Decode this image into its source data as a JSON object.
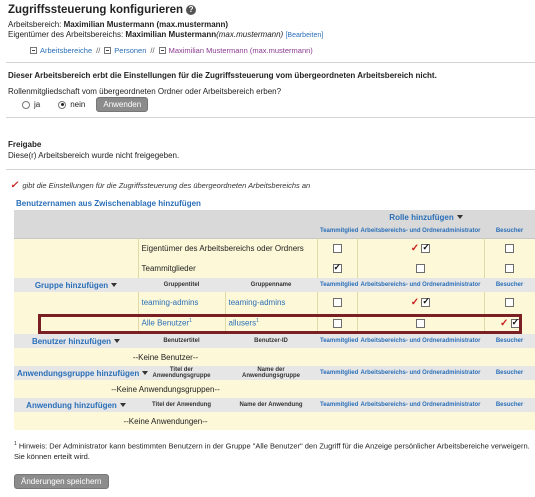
{
  "page": {
    "title": "Zugriffssteuerung konfigurieren",
    "workspace_label": "Arbeitsbereich:",
    "workspace_value": "Maximilian Mustermann (max.mustermann)",
    "owner_label": "Eigentümer des Arbeitsbereichs:",
    "owner_name": "Maximilian Mustermann",
    "owner_user": "(max.mustermann)",
    "edit_link": "[Bearbeiten]"
  },
  "breadcrumbs": {
    "items": [
      "Arbeitsbereiche",
      "Personen",
      "Maximilian Mustermann (max.mustermann)"
    ],
    "separator": "//"
  },
  "inherit": {
    "heading": "Dieser Arbeitsbereich erbt die Einstellungen für die Zugriffssteuerung vom übergeordneten Arbeitsbereich nicht.",
    "question": "Rollenmitgliedschaft vom übergeordneten Ordner oder Arbeitsbereich erben?",
    "option_yes": "ja",
    "option_no": "nein",
    "selected": "nein",
    "apply_button": "Anwenden"
  },
  "release": {
    "heading": "Freigabe",
    "text": "Diese(r) Arbeitsbereich wurde nicht freigegeben."
  },
  "legend_text": "gibt die Einstellungen für die Zugriffssteuerung des übergeordneten Arbeitsbereichs an",
  "clipboard_link": "Benutzernamen aus Zwischenablage hinzufügen",
  "table": {
    "add_role": "Rolle hinzufügen",
    "role_headers": [
      "Teammitglied",
      "Arbeitsbereichs- und Ordneradministrator",
      "Besucher"
    ],
    "special_rows": [
      {
        "label": "Eigentümer des Arbeitsbereichs oder Ordners",
        "team": false,
        "admin": true,
        "admin_inherited": true,
        "visitor": false,
        "visitor_inherited": false
      },
      {
        "label": "Teammitglieder",
        "team": true,
        "admin": false,
        "admin_inherited": false,
        "visitor": false,
        "visitor_inherited": false
      }
    ],
    "group_section": {
      "button": "Gruppe hinzufügen",
      "col1": "Gruppentitel",
      "col2": "Gruppenname",
      "rows": [
        {
          "title": "teaming-admins",
          "title_sup": "",
          "name": "teaming-admins",
          "name_sup": "",
          "team": false,
          "admin": true,
          "admin_inherited": true,
          "visitor": false,
          "visitor_inherited": false
        },
        {
          "title": "Alle Benutzer",
          "title_sup": "1",
          "name": "allusers",
          "name_sup": "1",
          "team": false,
          "admin": false,
          "admin_inherited": false,
          "visitor": true,
          "visitor_inherited": true
        }
      ]
    },
    "user_section": {
      "button": "Benutzer hinzufügen",
      "col1": "Benutzertitel",
      "col2": "Benutzer-ID",
      "empty": "--Keine Benutzer--"
    },
    "appgroup_section": {
      "button": "Anwendungsgruppe hinzufügen",
      "col1": "Titel der Anwendungsgruppe",
      "col2": "Name der Anwendungsgruppe",
      "empty": "--Keine Anwendungsgruppen--"
    },
    "app_section": {
      "button": "Anwendung hinzufügen",
      "col1": "Titel der Anwendung",
      "col2": "Name der Anwendung",
      "empty": "--Keine Anwendungen--"
    }
  },
  "footnote": {
    "sup": "1",
    "text": "Hinweis: Der Administrator kann bestimmten Benutzern in der Gruppe \"Alle Benutzer\" den Zugriff für die Anzeige persönlicher Arbeitsbereiche verweigern. Sie können erteilt wird."
  },
  "save_button": "Änderungen speichern",
  "colors": {
    "link": "#2a6fb8",
    "highlight_border": "#7a1f24",
    "inherited_check": "#cc1f1f",
    "row_bg": "#fdf8d8"
  }
}
